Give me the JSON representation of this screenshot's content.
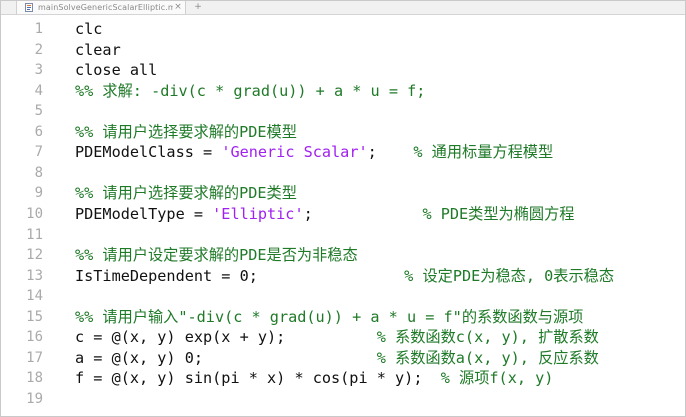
{
  "tab": {
    "label": "mainSolveGenericScalarElliptic.m",
    "close": "×",
    "add": "+"
  },
  "lines": [
    {
      "n": "1",
      "parts": [
        {
          "t": "clc",
          "c": "t-def"
        }
      ]
    },
    {
      "n": "2",
      "parts": [
        {
          "t": "clear",
          "c": "t-def"
        }
      ]
    },
    {
      "n": "3",
      "parts": [
        {
          "t": "close all",
          "c": "t-def"
        }
      ]
    },
    {
      "n": "4",
      "parts": [
        {
          "t": "%% 求解: -div(c * grad(u)) + a * u = f;",
          "c": "t-cmt"
        }
      ]
    },
    {
      "n": "5",
      "parts": []
    },
    {
      "n": "6",
      "parts": [
        {
          "t": "%% 请用户选择要求解的PDE模型",
          "c": "t-cmt"
        }
      ]
    },
    {
      "n": "7",
      "parts": [
        {
          "t": "PDEModelClass = ",
          "c": "t-def"
        },
        {
          "t": "'Generic Scalar'",
          "c": "t-str"
        },
        {
          "t": ";    ",
          "c": "t-def"
        },
        {
          "t": "% 通用标量方程模型",
          "c": "t-cmt"
        }
      ]
    },
    {
      "n": "8",
      "parts": []
    },
    {
      "n": "9",
      "parts": [
        {
          "t": "%% 请用户选择要求解的PDE类型",
          "c": "t-cmt"
        }
      ]
    },
    {
      "n": "10",
      "parts": [
        {
          "t": "PDEModelType = ",
          "c": "t-def"
        },
        {
          "t": "'Elliptic'",
          "c": "t-str"
        },
        {
          "t": ";            ",
          "c": "t-def"
        },
        {
          "t": "% PDE类型为椭圆方程",
          "c": "t-cmt"
        }
      ]
    },
    {
      "n": "11",
      "parts": []
    },
    {
      "n": "12",
      "parts": [
        {
          "t": "%% 请用户设定要求解的PDE是否为非稳态",
          "c": "t-cmt"
        }
      ]
    },
    {
      "n": "13",
      "parts": [
        {
          "t": "IsTimeDependent = 0;                ",
          "c": "t-def"
        },
        {
          "t": "% 设定PDE为稳态, 0表示稳态",
          "c": "t-cmt"
        }
      ]
    },
    {
      "n": "14",
      "parts": []
    },
    {
      "n": "15",
      "parts": [
        {
          "t": "%% 请用户输入\"-div(c * grad(u)) + a * u = f\"的系数函数与源项",
          "c": "t-cmt"
        }
      ]
    },
    {
      "n": "16",
      "parts": [
        {
          "t": "c = @(x, y) exp(x + y);          ",
          "c": "t-def"
        },
        {
          "t": "% 系数函数c(x, y), 扩散系数",
          "c": "t-cmt"
        }
      ]
    },
    {
      "n": "17",
      "parts": [
        {
          "t": "a = @(x, y) 0;                   ",
          "c": "t-def"
        },
        {
          "t": "% 系数函数a(x, y), 反应系数",
          "c": "t-cmt"
        }
      ]
    },
    {
      "n": "18",
      "parts": [
        {
          "t": "f = @(x, y) sin(pi * x) * cos(pi * y);  ",
          "c": "t-def"
        },
        {
          "t": "% 源项f(x, y)",
          "c": "t-cmt"
        }
      ]
    },
    {
      "n": "19",
      "parts": []
    }
  ]
}
